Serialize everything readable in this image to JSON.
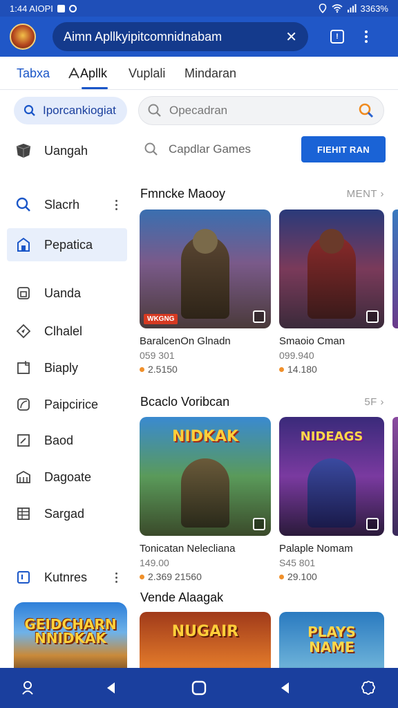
{
  "status_bar": {
    "time": "1:44 AIOPI",
    "battery": "3363%"
  },
  "header": {
    "url": "Aimn Apllkyipitcomnidnabam",
    "clear_glyph": "✕",
    "tabs_count": "!"
  },
  "top_tabs": [
    {
      "label": "Tabxa"
    },
    {
      "label": "Apllk"
    },
    {
      "label": "Vuplali"
    },
    {
      "label": "Mindaran"
    }
  ],
  "sidebar": {
    "search_label": "Iporcankiogiat",
    "items": [
      {
        "label": "Uangah",
        "icon": "cube-icon"
      },
      {
        "label": "Slacrh",
        "icon": "search-icon"
      },
      {
        "label": "Pepatica",
        "icon": "store-icon"
      },
      {
        "label": "Uanda",
        "icon": "archive-icon"
      },
      {
        "label": "Clhalel",
        "icon": "compass-icon"
      },
      {
        "label": "Biaply",
        "icon": "folder-icon"
      },
      {
        "label": "Paipcirice",
        "icon": "leaf-icon"
      },
      {
        "label": "Baod",
        "icon": "chart-icon"
      },
      {
        "label": "Dagoate",
        "icon": "building-icon"
      },
      {
        "label": "Sargad",
        "icon": "grid-icon"
      },
      {
        "label": "Kutnres",
        "icon": "flag-icon"
      }
    ],
    "promo_title": "GEIDCHARN NNIDKAK"
  },
  "main": {
    "search_placeholder": "Opecadran",
    "category_label": "Capdlar Games",
    "primary_button": "FIEHIT RAN",
    "sections": [
      {
        "title": "Fmncke Maooy",
        "more": "MENT",
        "cards": [
          {
            "name": "BaralcenOn Glnadn",
            "meta": "059 301",
            "rating": "2.5150",
            "tag": "WKGNG",
            "logo": ""
          },
          {
            "name": "Smaoio Cman",
            "meta": "099.940",
            "rating": "14.180",
            "tag": "",
            "logo": ""
          }
        ]
      },
      {
        "title": "Bcaclo Voribcan",
        "more": "5F",
        "cards": [
          {
            "name": "Tonicatan Nelecliana",
            "meta": "149.00",
            "rating": "2.369 21560",
            "tag": "",
            "logo": "NIDKAK"
          },
          {
            "name": "Palaple Nomam",
            "meta": "S45 801",
            "rating": "29.100",
            "tag": "",
            "logo": "NIDEAGS"
          }
        ]
      },
      {
        "title": "Vende Alaagak",
        "more": "",
        "cards": [
          {
            "name": "",
            "meta": "",
            "rating": "",
            "tag": "",
            "logo": "NUGAIR"
          },
          {
            "name": "",
            "meta": "",
            "rating": "",
            "tag": "",
            "logo": "PLAYS NAME"
          }
        ]
      }
    ]
  },
  "colors": {
    "brand": "#2057c7",
    "accent": "#1a63d6",
    "rating_dot": "#f0902b",
    "nav": "#1a3f9e"
  }
}
